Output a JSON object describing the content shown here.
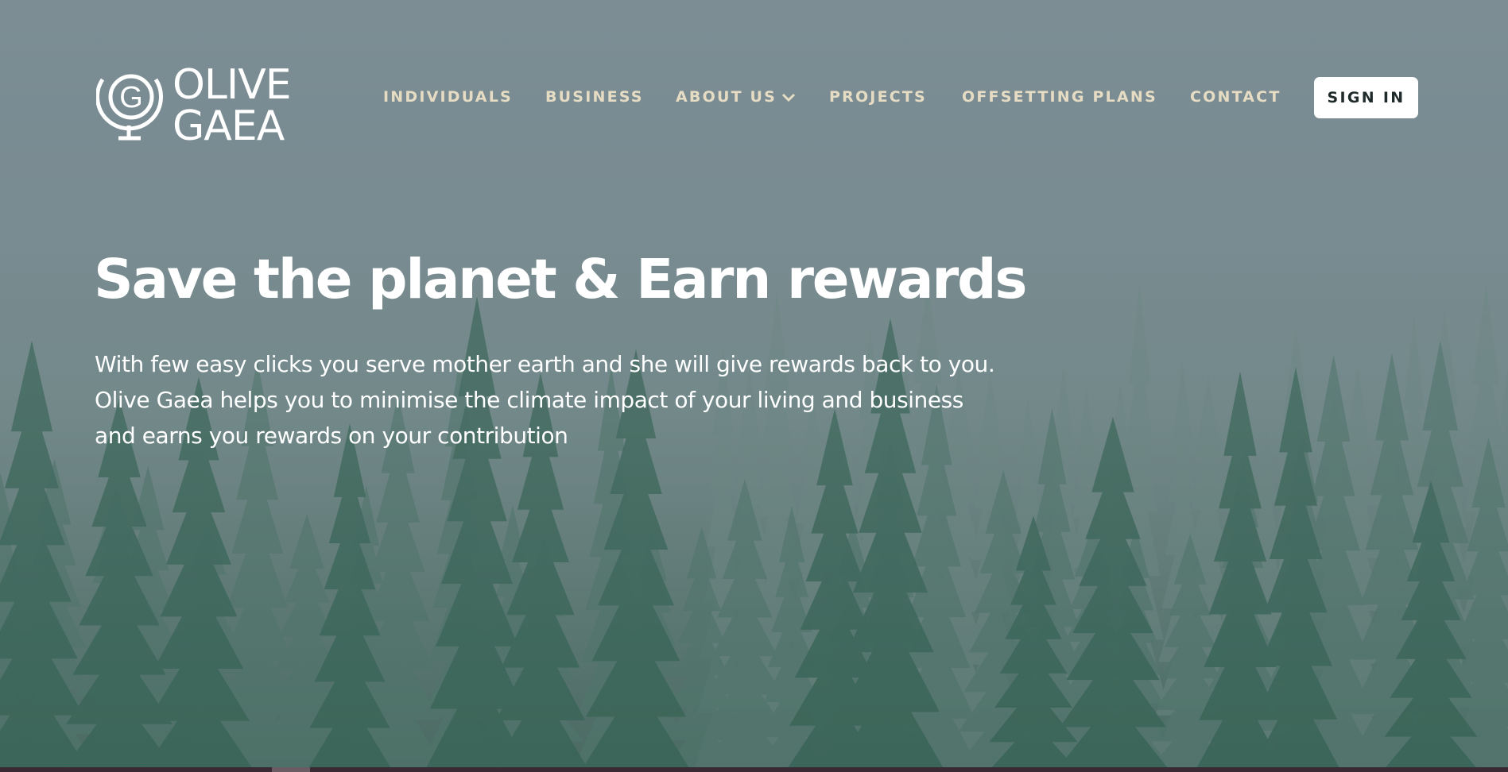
{
  "brand": {
    "logo_line1": "OLIVE",
    "logo_line2": "GAEA",
    "logo_letter": "G"
  },
  "nav": {
    "items": [
      {
        "label": "INDIVIDUALS"
      },
      {
        "label": "BUSINESS"
      },
      {
        "label": "ABOUT US",
        "icon": "chevron-down-icon"
      },
      {
        "label": "PROJECTS"
      },
      {
        "label": "OFFSETTING PLANS"
      },
      {
        "label": "CONTACT"
      }
    ],
    "signin_label": "SIGN IN"
  },
  "hero": {
    "headline": "Save the planet & Earn rewards",
    "subtext": "With few easy clicks you serve mother earth and she will give rewards back to you. Olive Gaea helps you to minimise the climate impact of your living and business and earns you rewards on your contribution",
    "background": "misty-pine-forest-image"
  },
  "colors": {
    "nav_text": "#e6dcc3",
    "headline": "#ffffff",
    "signin_bg": "#ffffff",
    "signin_text": "#1f2a2a",
    "sky": "#7c8d94",
    "forest": "#3f6a5c"
  }
}
